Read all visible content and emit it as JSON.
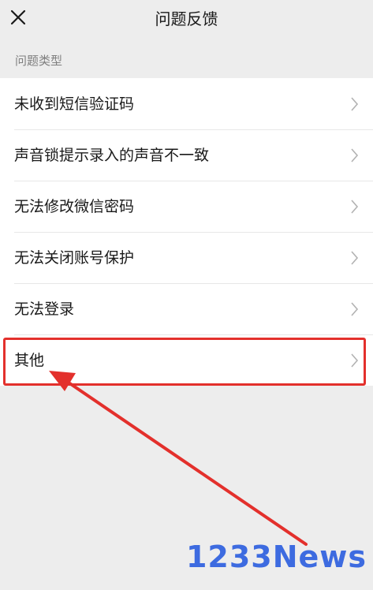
{
  "nav": {
    "title": "问题反馈",
    "close_icon": "close-icon"
  },
  "section": {
    "label": "问题类型"
  },
  "items": [
    {
      "label": "未收到短信验证码"
    },
    {
      "label": "声音锁提示录入的声音不一致"
    },
    {
      "label": "无法修改微信密码"
    },
    {
      "label": "无法关闭账号保护"
    },
    {
      "label": "无法登录"
    },
    {
      "label": "其他"
    }
  ],
  "annotation": {
    "highlight_color": "#e3302c",
    "highlighted_item": "其他"
  },
  "watermark": {
    "text": "1233News",
    "color": "#3d6be0"
  },
  "colors": {
    "background": "#ededed",
    "list_background": "#ffffff",
    "text": "#191919",
    "secondary_text": "#7f7f7f",
    "chevron": "#b2b2b2"
  }
}
